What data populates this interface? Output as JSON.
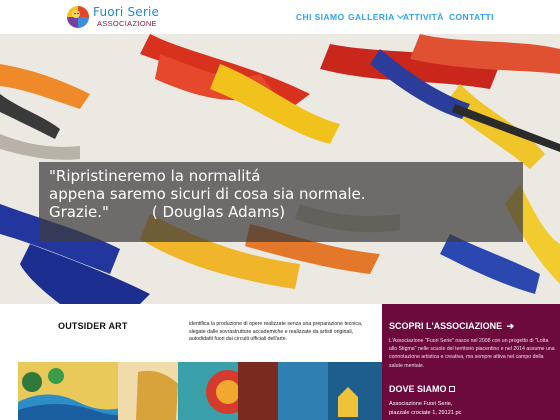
{
  "header": {
    "logo": {
      "line1": "Fuori Serie",
      "line2": "ASSOCIAZIONE"
    },
    "nav": [
      {
        "label": "CHI SIAMO",
        "has_dropdown": false
      },
      {
        "label": "GALLERIA",
        "has_dropdown": true
      },
      {
        "label": "ATTIVITÀ",
        "has_dropdown": false
      },
      {
        "label": "CONTATTI",
        "has_dropdown": false
      }
    ]
  },
  "hero": {
    "quote_lines": [
      "\"Ripristineremo la normalitá",
      "appena saremo sicuri di cosa sia normale.",
      "Grazie.\"         ( Douglas Adams)"
    ]
  },
  "outsider": {
    "title": "OUTSIDER ART",
    "description": "identifica la produzione di opere realizzate senza una preparazione tecnica, slegate dalle sovrastrutture accademiche e realizzate da artisti originali, autodidatti fuori dai circuiti ufficiali dell'arte."
  },
  "associazione": {
    "title": "SCOPRI L'ASSOCIAZIONE",
    "arrow": "➔",
    "description": "L'Associazione \"Fuori Serie\" nasce nel 2008 con un progetto di \"Lotta allo Stigma\" nelle scuole del territorio piacentino e nel 2014 assume una connotazione artistica e creativa, ma sempre attiva nel campo della salute mentale.",
    "dove_title": "DOVE SIAMO",
    "address_line1": "Associazione Fuori Serie,",
    "address_line2": " piazzale crociate 1, 29121 pc"
  },
  "colors": {
    "nav": "#2ea3f2",
    "purple_panel": "#6d0a3d",
    "logo_blue": "#1f8bd0",
    "logo_red": "#8a1b3e"
  }
}
